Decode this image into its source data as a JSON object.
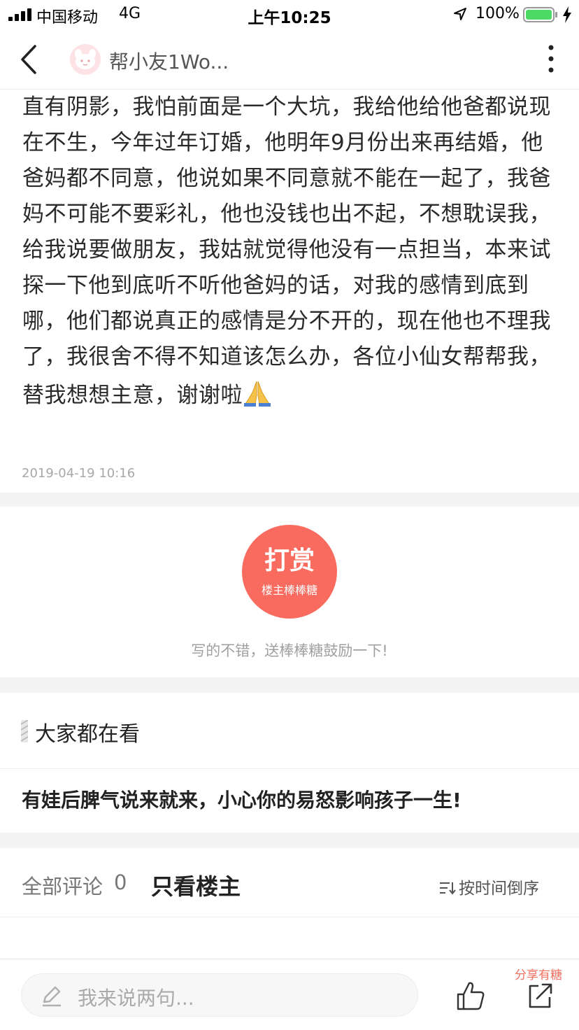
{
  "status_bar": {
    "carrier": "中国移动",
    "network": "4G",
    "time": "上午10:25",
    "battery": "100%"
  },
  "nav": {
    "title": "帮小友1Wo..."
  },
  "post": {
    "lines": [
      "直有阴影，我怕前面是一个大坑，我给他给他爸都说现",
      "在不生，今年过年订婚，他明年9月份出来再结婚，他",
      "爸妈都不同意，他说如果不同意就不能在一起了，我爸",
      "妈不可能不要彩礼，他也没钱也出不起，不想耽误我，",
      "给我说要做朋友，我姑就觉得他没有一点担当，本来试",
      "探一下他到底听不听他爸妈的话，对我的感情到底到",
      "哪，他们都说真正的感情是分不开的，现在他也不理我",
      "了，我很舍不得不知道该怎么办，各位小仙女帮帮我，",
      "替我想想主意，谢谢啦"
    ],
    "date": "2019-04-19 10:16"
  },
  "reward": {
    "title": "打赏",
    "subtitle": "楼主棒棒糖",
    "tip": "写的不错，送棒棒糖鼓励一下!"
  },
  "related": {
    "title": "大家都在看",
    "items": [
      "有娃后脾气说来就来，小心你的易怒影响孩子一生!"
    ]
  },
  "comments": {
    "all_label": "全部评论",
    "count": "0",
    "owner_only_label": "只看楼主",
    "sort_label": "按时间倒序"
  },
  "bottom_bar": {
    "input_placeholder": "我来说两句...",
    "share_label": "分享有糖"
  },
  "colors": {
    "accent": "#f96b5e",
    "share_text": "#f07060",
    "battery_green": "#4cd964"
  }
}
